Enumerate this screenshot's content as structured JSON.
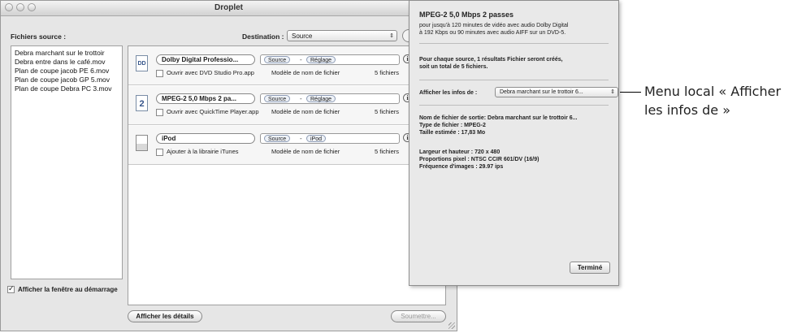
{
  "window": {
    "title": "Droplet"
  },
  "source_files": {
    "label": "Fichiers source :",
    "items": [
      "Debra marchant sur le trottoir",
      "Debra entre dans le café.mov",
      "Plan de coupe jacob PE 6.mov",
      "Plan de coupe jacob  GP 5.mov",
      "Plan de coupe Debra PC 3.mov"
    ]
  },
  "destination": {
    "label": "Destination :",
    "value": "Source"
  },
  "settings": [
    {
      "name": "Dolby Digital Professio...",
      "icon": "dd-icon",
      "icon_text": "DD",
      "token1": "Source",
      "token2": "Réglage",
      "open_with": "Ouvrir avec DVD Studio Pro.app",
      "template": "Modèle de nom de fichier",
      "count": "5 fichiers"
    },
    {
      "name": "MPEG-2 5,0 Mbps 2 pa...",
      "icon": "mpeg2-icon",
      "icon_text": "2",
      "token1": "Source",
      "token2": "Réglage",
      "open_with": "Ouvrir avec QuickTime Player.app",
      "template": "Modèle de nom de fichier",
      "count": "5 fichiers"
    },
    {
      "name": "iPod",
      "icon": "ipod-icon",
      "icon_text": "",
      "token1": "Source",
      "token2": "iPod",
      "open_with": "Ajouter à la librairie iTunes",
      "template": "Modèle de nom de fichier",
      "count": "5 fichiers"
    }
  ],
  "show_at_startup": {
    "label": "Afficher la fenêtre au démarrage",
    "checked": true
  },
  "buttons": {
    "details": "Afficher les détails",
    "submit": "Soumettre..."
  },
  "drawer": {
    "title": "MPEG-2 5,0 Mbps 2 passes",
    "desc_line1": "pour jusqu'à 120 minutes de vidéo avec audio Dolby Digital",
    "desc_line2": "à 192 Kbps ou 90 minutes avec audio AIFF sur un DVD-5.",
    "result_line1": "Pour chaque source, 1 résultats Fichier  seront créés,",
    "result_line2": "soit un total de 5 fichiers.",
    "show_info_label": "Afficher les infos de :",
    "show_info_value": "Debra marchant sur le trottoir 6...",
    "output_name": "Nom de fichier de sortie: Debra marchant sur le trottoir 6...",
    "file_type": "Type de fichier : MPEG-2",
    "est_size": "Taille estimée : 17,83 Mo",
    "dimensions": "Largeur et hauteur : 720 x 480",
    "pixel_aspect": "Proportions pixel : NTSC CCIR 601/DV (16/9)",
    "frame_rate": "Fréquence d'images : 29.97 ips",
    "done": "Terminé"
  },
  "callout": {
    "line1": "Menu local « Afficher",
    "line2": "les infos de »"
  }
}
